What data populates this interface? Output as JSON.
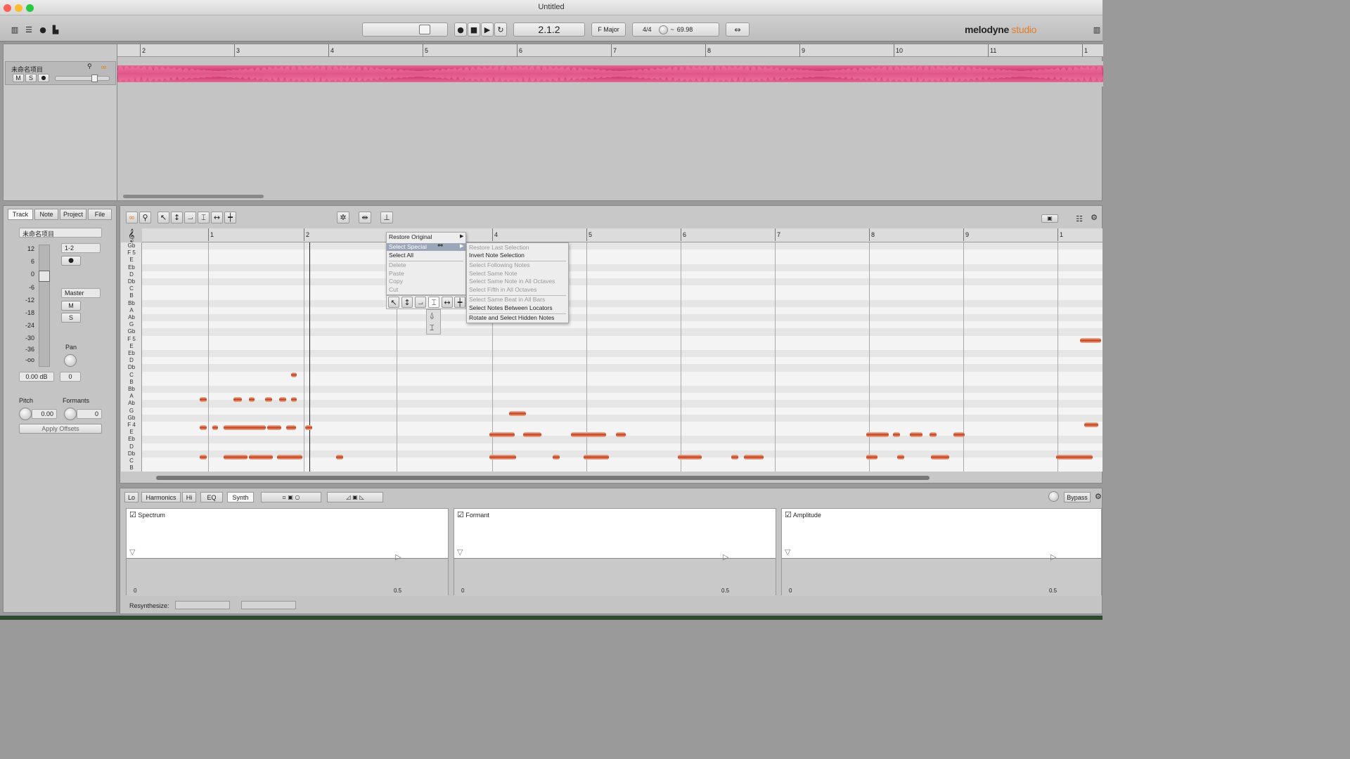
{
  "window": {
    "title": "Untitled"
  },
  "toolbar": {
    "position": "2.1.2",
    "key": "F Major",
    "time_sig": "4/4",
    "tempo": "69.98",
    "tempo_prefix": "~",
    "logo_main": "melodyne",
    "logo_sub": "studio"
  },
  "arrange": {
    "track_name": "未命名项目",
    "mute": "M",
    "solo": "S",
    "ruler": [
      "2",
      "3",
      "4",
      "5",
      "6",
      "7",
      "8",
      "9",
      "10",
      "11",
      "1"
    ]
  },
  "left_panel": {
    "tabs": [
      "Track",
      "Note",
      "Project",
      "File"
    ],
    "track_name": "未命名项目",
    "db_scale": [
      "12",
      "6",
      "0",
      "-6",
      "-12",
      "-18",
      "-24",
      "-30",
      "-36",
      "-oo"
    ],
    "input": "1-2",
    "output": "Master",
    "m": "M",
    "s": "S",
    "pan_label": "Pan",
    "gain_value": "0.00 dB",
    "pan_value": "0",
    "pitch_label": "Pitch",
    "pitch_value": "0.00",
    "formants_label": "Formants",
    "formants_value": "0",
    "apply": "Apply Offsets"
  },
  "editor": {
    "ruler": [
      "1",
      "2",
      "4",
      "5",
      "6",
      "7",
      "8",
      "9",
      "1"
    ],
    "keys": [
      "Gb",
      "F 5",
      "E",
      "Eb",
      "D",
      "Db",
      "C",
      "B",
      "Bb",
      "A",
      "Ab",
      "G",
      "Gb",
      "F 5",
      "E",
      "Eb",
      "D",
      "Db",
      "C",
      "B",
      "Bb",
      "A",
      "Ab",
      "G",
      "Gb",
      "F 4",
      "E",
      "Eb",
      "D",
      "Db",
      "C",
      "B"
    ]
  },
  "context_menu": {
    "items": [
      "Restore Original",
      "Select Special",
      "Select All",
      "Delete",
      "Paste",
      "Copy",
      "Cut"
    ],
    "submenu": [
      "Restore Last Selection",
      "Invert Note Selection",
      "Select Following Notes",
      "Select Same Note",
      "Select Same Note in All Octaves",
      "Select Fifth in All Octaves",
      "Select Same Beat in All Bars",
      "Select Notes Between Locators",
      "Rotate and Select Hidden Notes"
    ]
  },
  "synth": {
    "tabs": [
      "Lo",
      "Harmonics",
      "Hi",
      "EQ",
      "Synth"
    ],
    "bypass": "Bypass",
    "panes": [
      {
        "label": "Spectrum",
        "min": "0",
        "max": "0.5"
      },
      {
        "label": "Formant",
        "min": "0",
        "max": "0.5"
      },
      {
        "label": "Amplitude",
        "min": "0",
        "max": "0.5"
      }
    ],
    "resynth_label": "Resynthesize:"
  },
  "colors": {
    "accent": "#e07f2a",
    "wave": "#d0306a",
    "note": "#c0401e"
  }
}
